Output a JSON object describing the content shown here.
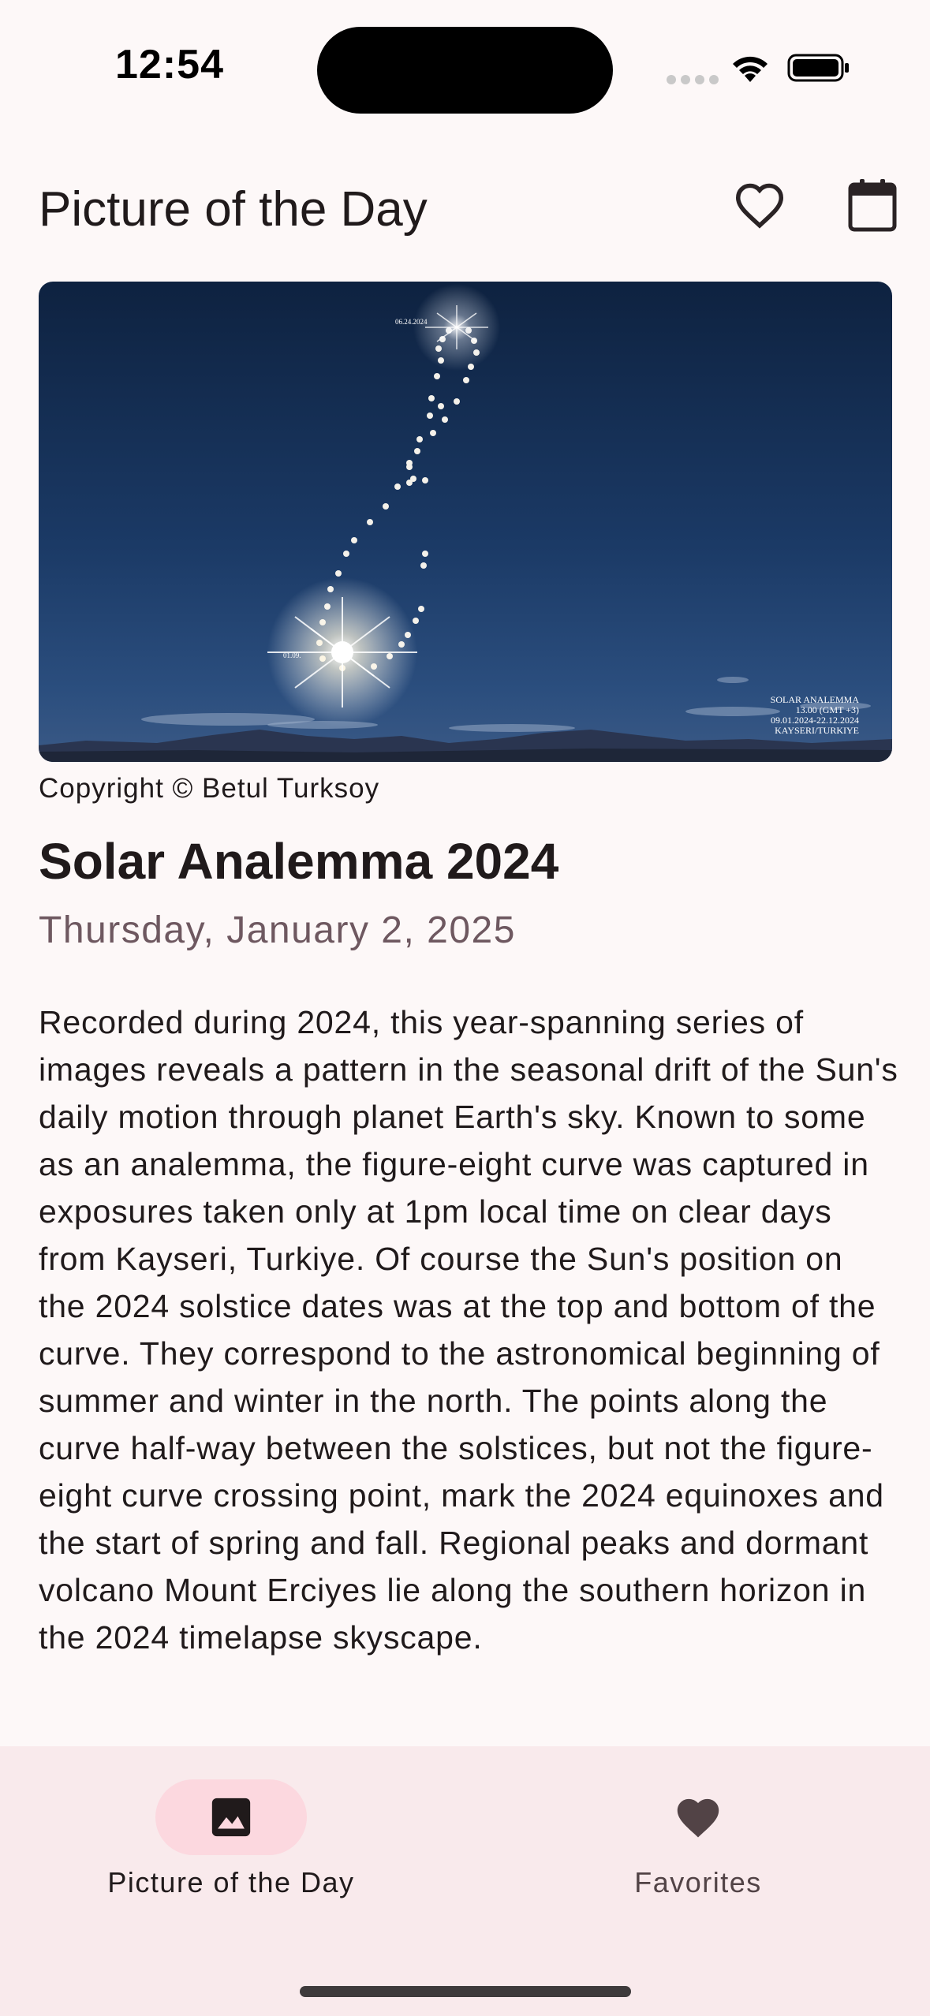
{
  "status_bar": {
    "time": "12:54"
  },
  "app_bar": {
    "title": "Picture of the Day",
    "favorite_icon": "heart-outline-icon",
    "calendar_icon": "calendar-icon"
  },
  "apod": {
    "image_overlay": {
      "top_date": "06.24.2024",
      "bottom_date": "01.09.",
      "caption_line1": "SOLAR ANALEMMA",
      "caption_line2": "13.00 (GMT +3)",
      "caption_line3": "09.01.2024-22.12.2024",
      "caption_line4": "KAYSERI/TURKIYE"
    },
    "copyright": "Copyright © Betul Turksoy",
    "title": "Solar Analemma 2024",
    "date": "Thursday, January 2, 2025",
    "explanation": "Recorded during 2024, this year-spanning series of images reveals a pattern in the seasonal drift of the Sun's daily motion through planet Earth's sky. Known to some as an analemma, the figure-eight curve was captured in exposures taken only at 1pm local time on clear days from Kayseri, Turkiye. Of course the Sun's position on the 2024 solstice dates was at the top and bottom of the curve. They correspond to the astronomical beginning of summer and winter in the north. The points along the curve half-way between the solstices, but not the figure-eight curve crossing point, mark the 2024 equinoxes and the start of spring and fall. Regional peaks and dormant volcano Mount Erciyes lie along the southern horizon in the 2024 timelapse skyscape."
  },
  "bottom_nav": {
    "items": [
      {
        "label": "Picture of the Day",
        "icon": "image-icon",
        "selected": true
      },
      {
        "label": "Favorites",
        "icon": "heart-filled-icon",
        "selected": false
      }
    ]
  },
  "colors": {
    "background": "#fdf8f8",
    "nav_background": "#f9eaec",
    "active_pill": "#fcd8df",
    "date_text": "#6e5860"
  }
}
